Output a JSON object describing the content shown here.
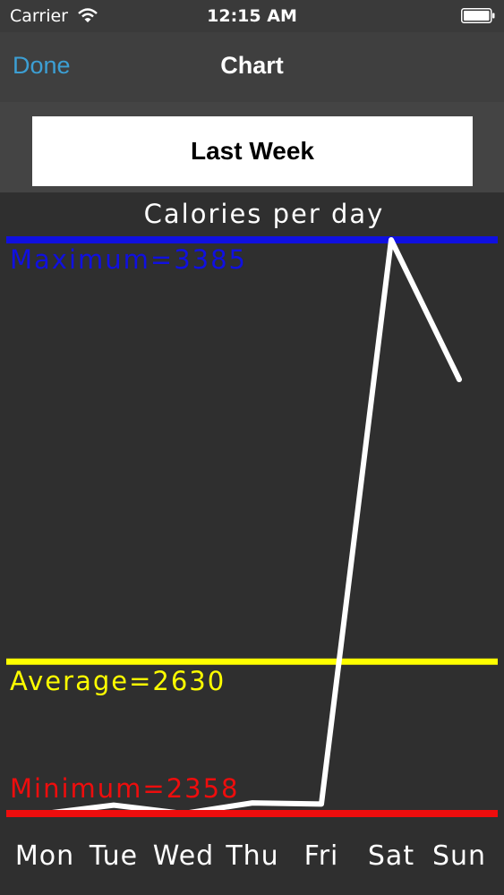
{
  "status_bar": {
    "carrier": "Carrier",
    "time": "12:15 AM",
    "icons": [
      "wifi-icon",
      "battery-icon"
    ]
  },
  "nav": {
    "back_label": "Done",
    "title": "Chart"
  },
  "period": {
    "label": "Last Week"
  },
  "colors": {
    "background": "#2f2f2f",
    "nav": "#3f3f3f",
    "accent": "#3c9fd4",
    "max_line": "#1010e0",
    "avg_line": "#ffff00",
    "min_line": "#ee0d0d",
    "series": "#ffffff"
  },
  "chart_data": {
    "type": "line",
    "title": "Calories per day",
    "categories": [
      "Mon",
      "Tue",
      "Wed",
      "Thu",
      "Fri",
      "Sat",
      "Sun"
    ],
    "values": [
      2358,
      2373,
      2358,
      2377,
      2375,
      3385,
      3135
    ],
    "reference_lines": [
      {
        "label": "Maximum=3385",
        "value": 3385
      },
      {
        "label": "Average=2630",
        "value": 2630
      },
      {
        "label": "Minimum=2358",
        "value": 2358
      }
    ]
  }
}
